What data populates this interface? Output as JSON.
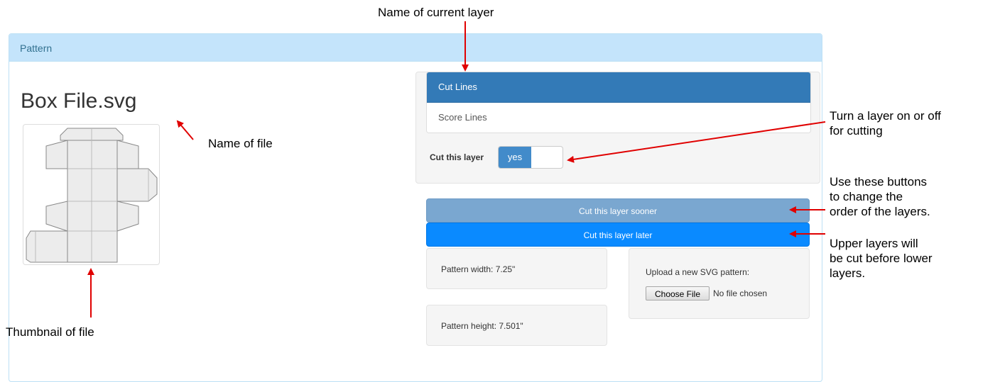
{
  "panel": {
    "heading": "Pattern"
  },
  "file": {
    "title": "Box File.svg"
  },
  "layers": [
    {
      "label": "Cut Lines",
      "active": true
    },
    {
      "label": "Score Lines",
      "active": false
    }
  ],
  "cut_toggle": {
    "label": "Cut this layer",
    "value": "yes"
  },
  "buttons": {
    "sooner": "Cut this layer sooner",
    "later": "Cut this layer later"
  },
  "pattern": {
    "width": "Pattern width: 7.25\"",
    "height": "Pattern height: 7.501\""
  },
  "upload": {
    "label": "Upload a new SVG pattern:",
    "button": "Choose File",
    "status": "No file chosen"
  },
  "annotations": {
    "current_layer": "Name of current layer",
    "name_of_file": "Name of file",
    "thumbnail": "Thumbnail of file",
    "toggle_line1": "Turn a layer on or off",
    "toggle_line2": "for cutting",
    "order_line1": "Use these buttons",
    "order_line2": "to change the",
    "order_line3": "order of the layers.",
    "upper_line1": "Upper layers will",
    "upper_line2": "be cut before lower",
    "upper_line3": "layers."
  },
  "colors": {
    "panel_heading": "#c4e4fb",
    "active_layer": "#337ab7",
    "toggle_on": "#428bca",
    "btn_sooner": "#7aa7d0",
    "btn_later": "#0a8aff",
    "arrow": "#e00000"
  }
}
